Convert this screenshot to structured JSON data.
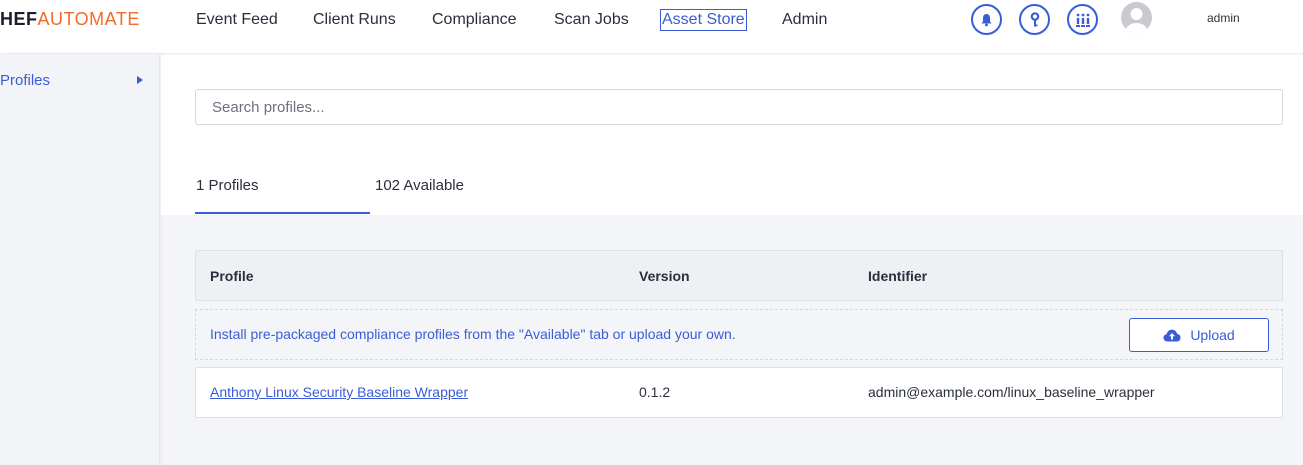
{
  "brand": {
    "part1": "HEF",
    "part2": "AUTOMATE"
  },
  "nav": [
    "Event Feed",
    "Client Runs",
    "Compliance",
    "Scan Jobs",
    "Asset Store",
    "Admin"
  ],
  "active_nav": "Asset Store",
  "header_icons": [
    "bell-icon",
    "key-icon",
    "grid-menu-icon"
  ],
  "user": {
    "name": "admin"
  },
  "sidebar": {
    "items": [
      {
        "label": "Profiles"
      }
    ]
  },
  "search": {
    "placeholder": "Search profiles...",
    "value": ""
  },
  "tabs": [
    {
      "label": "1 Profiles",
      "active": true
    },
    {
      "label": "102 Available",
      "active": false
    }
  ],
  "table": {
    "headers": [
      "Profile",
      "Version",
      "Identifier"
    ],
    "info": "Install pre-packaged compliance profiles from the \"Available\" tab or upload your own.",
    "upload_label": "Upload",
    "rows": [
      {
        "profile": "Anthony Linux Security Baseline Wrapper",
        "version": "0.1.2",
        "identifier": "admin@example.com/linux_baseline_wrapper"
      }
    ]
  },
  "colors": {
    "accent": "#3b5cd6",
    "brand_orange": "#f06a2a",
    "background": "#f4f5f8"
  }
}
